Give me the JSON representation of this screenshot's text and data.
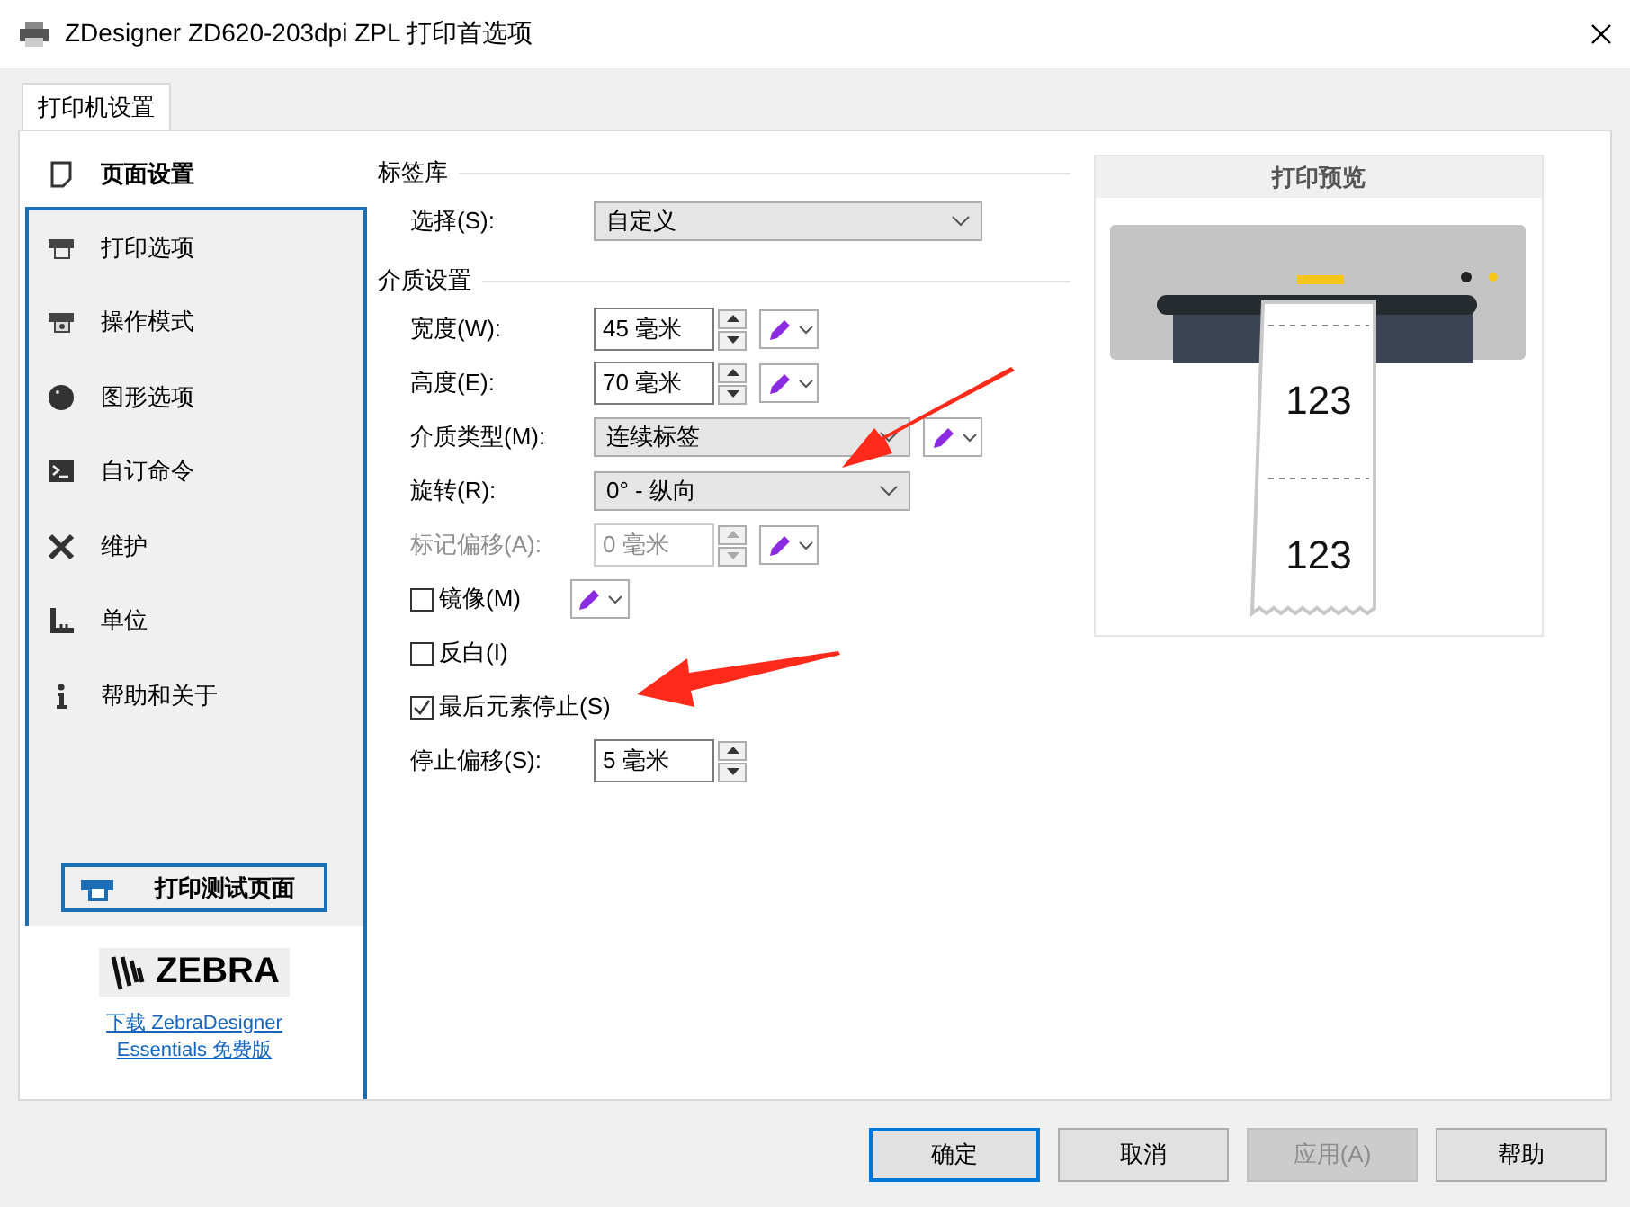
{
  "window": {
    "title": "ZDesigner ZD620-203dpi ZPL 打印首选项"
  },
  "tabs": [
    {
      "label": "打印机设置",
      "selected": true
    }
  ],
  "sidebar": {
    "items": [
      {
        "label": "页面设置",
        "selected": true
      },
      {
        "label": "打印选项",
        "selected": false
      },
      {
        "label": "操作模式",
        "selected": false
      },
      {
        "label": "图形选项",
        "selected": false
      },
      {
        "label": "自订命令",
        "selected": false
      },
      {
        "label": "维护",
        "selected": false
      },
      {
        "label": "单位",
        "selected": false
      },
      {
        "label": "帮助和关于",
        "selected": false
      }
    ],
    "test_button": "打印测试页面",
    "logo": "ZEBRA",
    "download_link": [
      "下载 ZebraDesigner",
      "Essentials 免费版"
    ]
  },
  "sections": [
    {
      "title": "标签库",
      "fields": [
        {
          "kind": "select",
          "label": "选择(S):",
          "value": "自定义",
          "disabled": false,
          "pencil": false
        }
      ]
    },
    {
      "title": "介质设置",
      "fields": [
        {
          "kind": "spin",
          "label": "宽度(W):",
          "value": "45 毫米",
          "disabled": false,
          "pencil": true
        },
        {
          "kind": "spin",
          "label": "高度(E):",
          "value": "70 毫米",
          "disabled": false,
          "pencil": true
        },
        {
          "kind": "select",
          "label": "介质类型(M):",
          "value": "连续标签",
          "disabled": false,
          "pencil": true
        },
        {
          "kind": "select",
          "label": "旋转(R):",
          "value": "0° - 纵向",
          "disabled": false,
          "pencil": false
        },
        {
          "kind": "spin",
          "label": "标记偏移(A):",
          "value": "0 毫米",
          "disabled": true,
          "pencil": true
        },
        {
          "kind": "checkbox",
          "label": "镜像(M)",
          "checked": false,
          "pencil": true
        },
        {
          "kind": "checkbox",
          "label": "反白(I)",
          "checked": false,
          "pencil": false
        },
        {
          "kind": "checkbox",
          "label": "最后元素停止(S)",
          "checked": true,
          "pencil": false
        },
        {
          "kind": "spin",
          "label": "停止偏移(S):",
          "value": "5 毫米",
          "disabled": false,
          "pencil": false
        }
      ]
    }
  ],
  "preview": {
    "title": "打印预览",
    "labels": [
      "123",
      "123"
    ]
  },
  "buttons": [
    {
      "label": "确定",
      "default": true,
      "disabled": false
    },
    {
      "label": "取消",
      "default": false,
      "disabled": false
    },
    {
      "label": "应用(A)",
      "default": false,
      "disabled": true
    },
    {
      "label": "帮助",
      "default": false,
      "disabled": false
    }
  ]
}
